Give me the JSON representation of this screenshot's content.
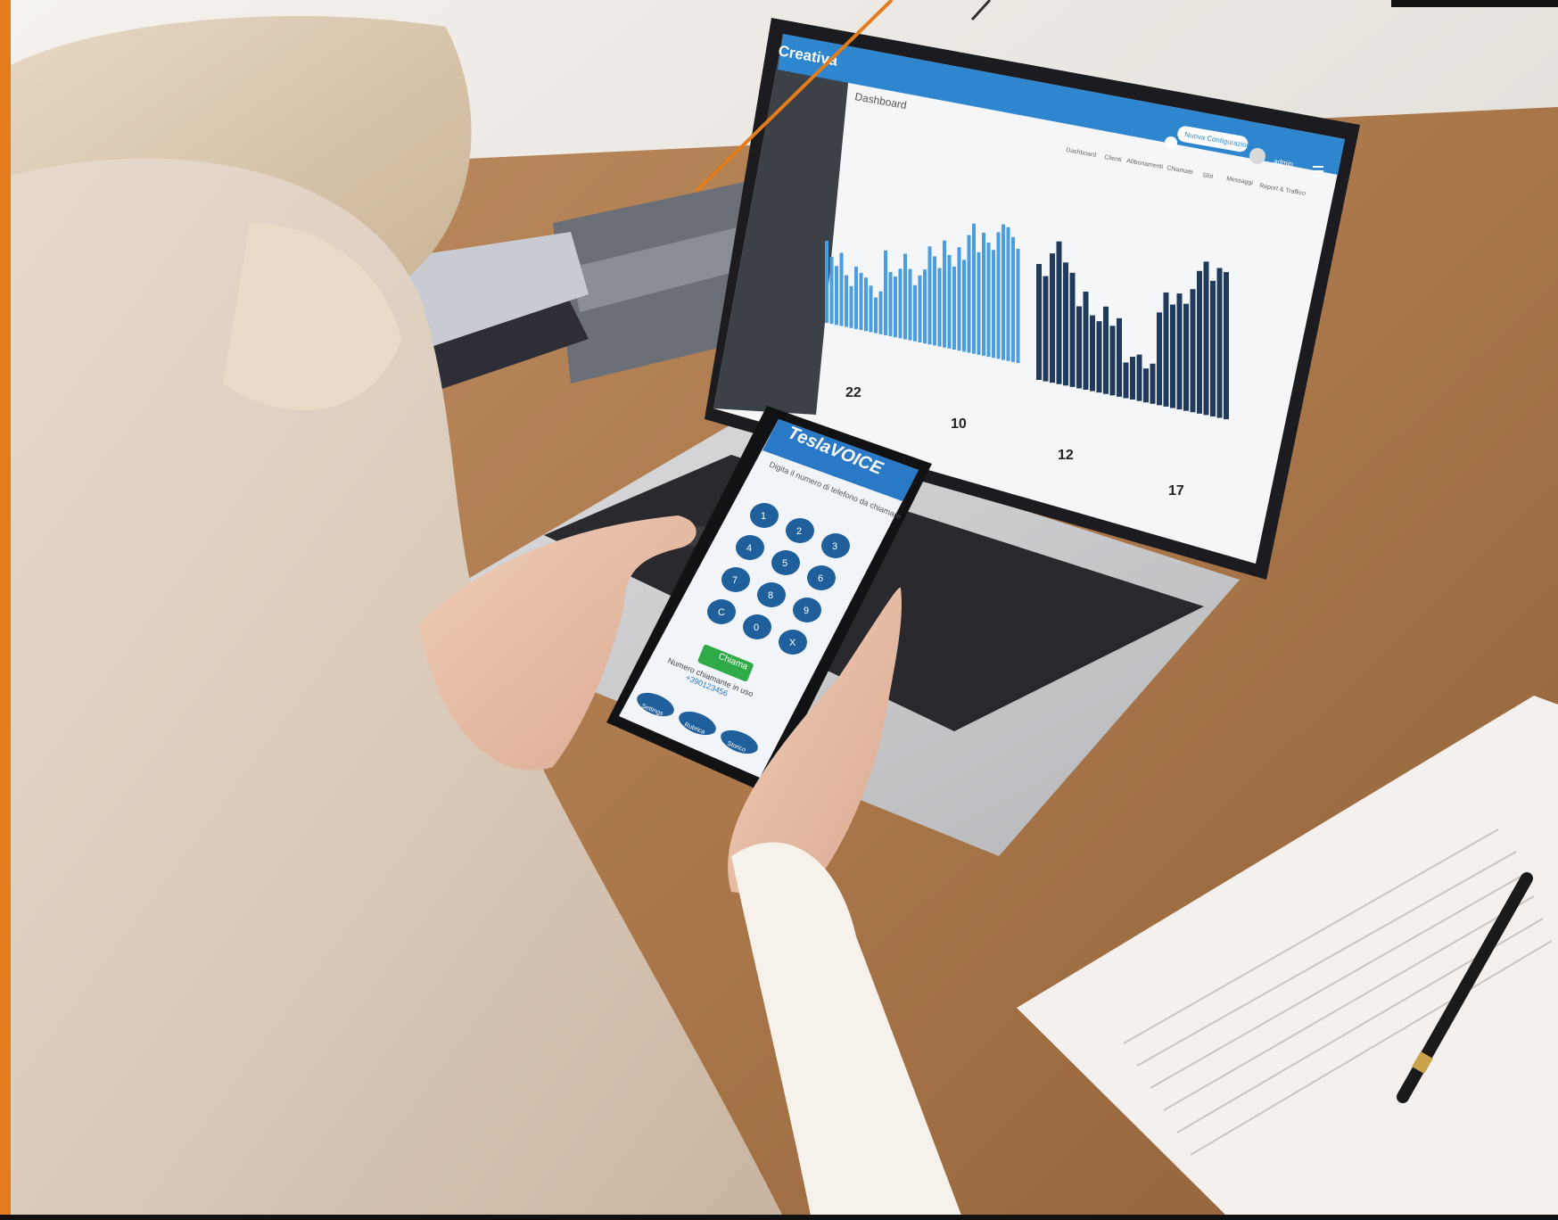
{
  "laptop": {
    "brand": "Creativa",
    "page_title": "Dashboard",
    "config_button": "Nuova Configurazione",
    "user": "admin",
    "tabs": [
      "Dashboard",
      "Clienti",
      "Abbonamenti",
      "Chiamate",
      "Slot",
      "Messaggi",
      "Report & Traffico"
    ],
    "stats": [
      "22",
      "10",
      "12",
      "17"
    ],
    "colors": {
      "sidebar": "#3c4147",
      "header": "#2e86cf",
      "bar_light": "#4a9de0",
      "bar_dark": "#1f3a5c"
    },
    "chart_left": {
      "type": "bar",
      "values": [
        92,
        75,
        66,
        82,
        58,
        47,
        70,
        64,
        60,
        52,
        40,
        48,
        95,
        72,
        68,
        78,
        96,
        80,
        63,
        75,
        83,
        110,
        100,
        88,
        120,
        105,
        93,
        116,
        103,
        132,
        146,
        115,
        138,
        128,
        121,
        142,
        152,
        150,
        140,
        128
      ]
    },
    "chart_right": {
      "type": "bar",
      "values": [
        130,
        118,
        145,
        160,
        138,
        128,
        92,
        110,
        85,
        80,
        98,
        78,
        88,
        40,
        48,
        52,
        38,
        45,
        104,
        128,
        116,
        130,
        120,
        138,
        160,
        172,
        152,
        168,
        165
      ]
    }
  },
  "phone": {
    "app_name": "TeslaVOICE",
    "prompt": "Digita il numero di telefono da chiamare",
    "keypad": [
      "1",
      "2",
      "3",
      "4",
      "5",
      "6",
      "7",
      "8",
      "9",
      "C",
      "0",
      "X"
    ],
    "call_button": "Chiama",
    "footer_text": "Numero chiamante in uso",
    "footer_link": "+390123456",
    "nav_buttons": [
      "Settings",
      "Rubrica",
      "Storico"
    ],
    "colors": {
      "header": "#2a79c6",
      "key": "#1f5f9c",
      "call": "#2eaa47"
    }
  },
  "icons": [
    "phone-icon",
    "bell-icon",
    "menu-icon",
    "pen-icon",
    "user-avatar-icon"
  ]
}
